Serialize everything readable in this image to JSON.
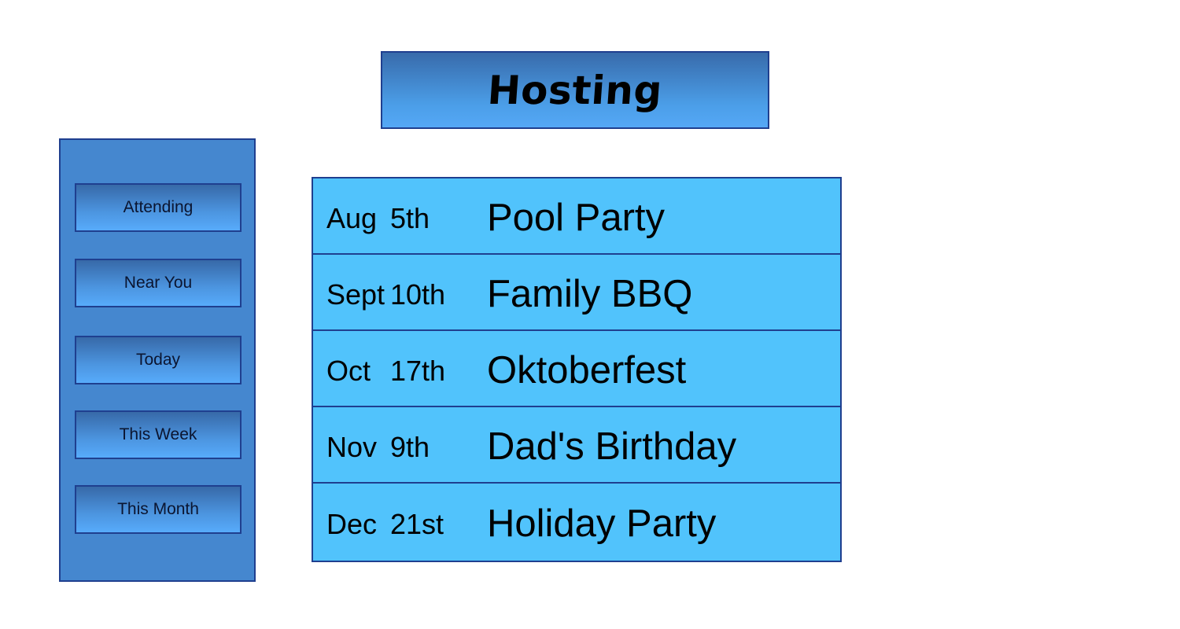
{
  "header": {
    "title": "Hosting"
  },
  "sidebar": {
    "items": [
      {
        "label": "Attending"
      },
      {
        "label": "Near You"
      },
      {
        "label": "Today"
      },
      {
        "label": "This Week"
      },
      {
        "label": "This Month"
      }
    ]
  },
  "events": [
    {
      "month": "Aug",
      "day": "5th",
      "name": "Pool Party"
    },
    {
      "month": "Sept",
      "day": "10th",
      "name": "Family BBQ"
    },
    {
      "month": "Oct",
      "day": "17th",
      "name": "Oktoberfest"
    },
    {
      "month": "Nov",
      "day": "9th",
      "name": "Dad's Birthday"
    },
    {
      "month": "Dec",
      "day": "21st",
      "name": "Holiday Party"
    }
  ],
  "colors": {
    "border": "#1f3f8f",
    "sidebar_bg": "#4587cf",
    "event_bg": "#51c3fc",
    "button_top": "#3769a8",
    "button_bottom": "#57abfb"
  }
}
